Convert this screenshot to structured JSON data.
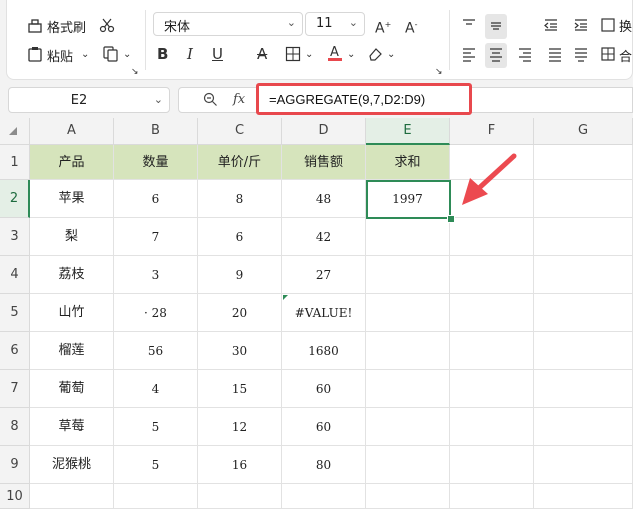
{
  "ribbon": {
    "format_painter_label": "格式刷",
    "paste_label": "粘贴",
    "font_name": "宋体",
    "font_size": "11",
    "wrap_label": "换",
    "merge_label": "合"
  },
  "formula_bar": {
    "name_box": "E2",
    "fx_label": "fx",
    "formula": "=AGGREGATE(9,7,D2:D9)"
  },
  "columns": [
    "A",
    "B",
    "C",
    "D",
    "E",
    "F",
    "G"
  ],
  "rows": [
    "1",
    "2",
    "3",
    "4",
    "5",
    "6",
    "7",
    "8",
    "9",
    "10"
  ],
  "table": {
    "headers": [
      "产品",
      "数量",
      "单价/斤",
      "销售额",
      "求和"
    ],
    "rows": [
      [
        "苹果",
        "6",
        "8",
        "48",
        "1997"
      ],
      [
        "梨",
        "7",
        "6",
        "42",
        ""
      ],
      [
        "荔枝",
        "3",
        "9",
        "27",
        ""
      ],
      [
        "山竹",
        "· 28",
        "20",
        "#VALUE!",
        ""
      ],
      [
        "榴莲",
        "56",
        "30",
        "1680",
        ""
      ],
      [
        "葡萄",
        "4",
        "15",
        "60",
        ""
      ],
      [
        "草莓",
        "5",
        "12",
        "60",
        ""
      ],
      [
        "泥猴桃",
        "5",
        "16",
        "80",
        ""
      ]
    ]
  },
  "colors": {
    "header_fill": "#d6e4bc",
    "selection": "#2e8b57",
    "highlight_box": "#e8484d",
    "arrow": "#ec4a50"
  }
}
